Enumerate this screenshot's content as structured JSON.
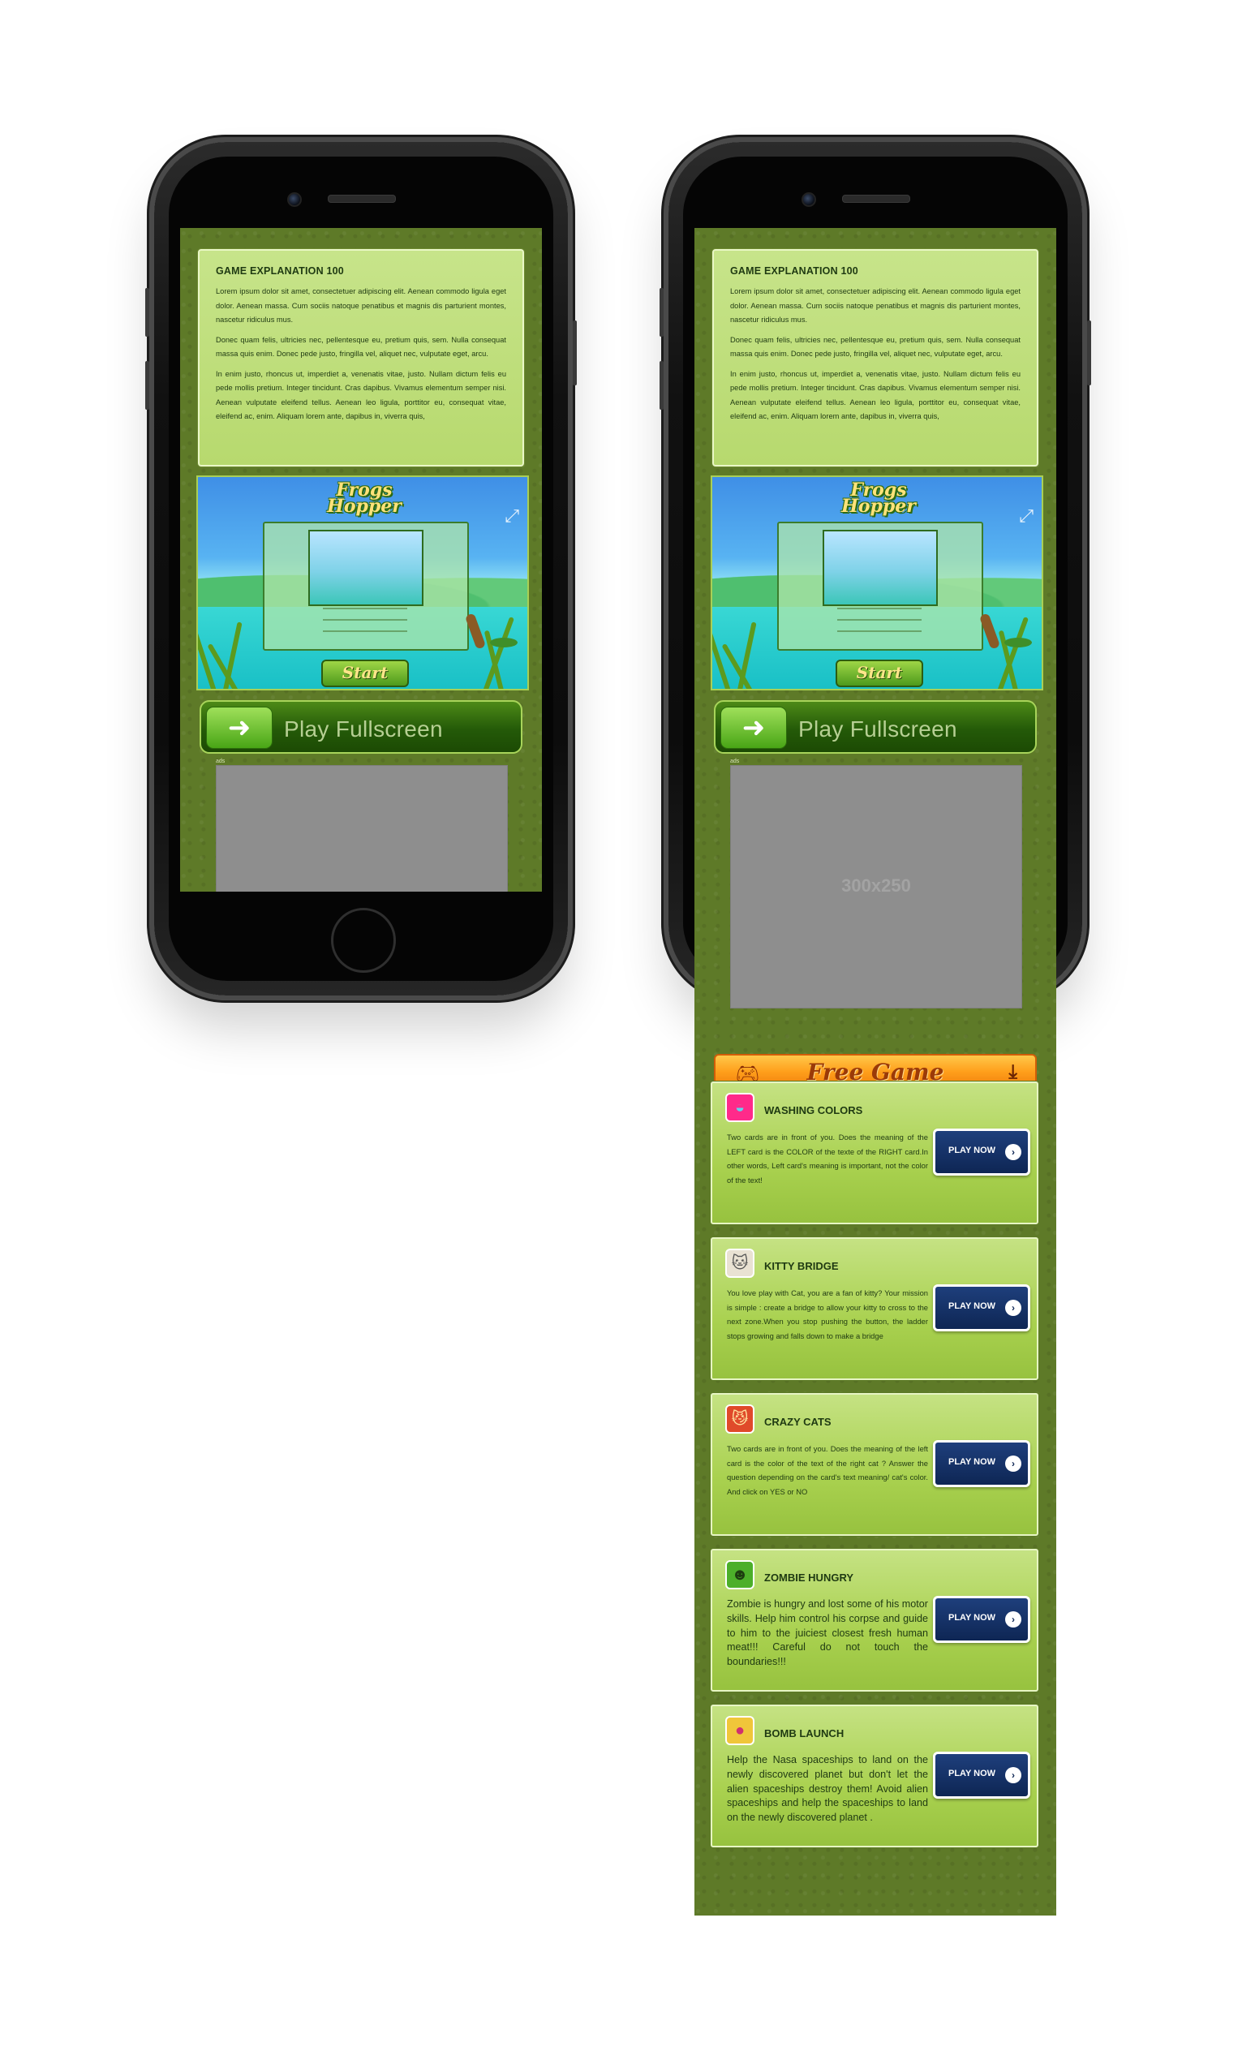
{
  "explanation": {
    "title": "GAME EXPLANATION 100",
    "p1": "Lorem ipsum dolor sit amet, consectetuer adipiscing elit. Aenean commodo ligula eget dolor. Aenean massa. Cum sociis natoque penatibus et magnis dis parturient montes, nascetur ridiculus mus.",
    "p2": "Donec quam felis, ultricies nec, pellentesque eu, pretium quis, sem. Nulla consequat massa quis enim. Donec pede justo, fringilla vel, aliquet nec, vulputate eget, arcu.",
    "p3": "In enim justo, rhoncus ut, imperdiet a, venenatis vitae, justo. Nullam dictum felis eu pede mollis pretium. Integer tincidunt. Cras dapibus. Vivamus elementum semper nisi. Aenean vulputate eleifend tellus. Aenean leo ligula, porttitor eu, consequat vitae, eleifend ac, enim. Aliquam lorem ante, dapibus in, viverra quis,"
  },
  "game": {
    "title_line1": "Frogs",
    "title_line2": "Hopper",
    "start_label": "Start",
    "fullscreen_icon": "expand-icon"
  },
  "play_fullscreen": {
    "label": "Play Fullscreen",
    "icon": "arrow-right-icon"
  },
  "ads": {
    "label": "ads",
    "placeholder": "300x250"
  },
  "free_game": {
    "label": "Free Game",
    "left_icon": "gamepad-icon",
    "right_icon": "download-icon"
  },
  "games": [
    {
      "title": "WASHING COLORS",
      "desc": "Two cards are in front of you. Does the meaning of the LEFT card is the COLOR of the texte of the RIGHT card.In other words, Left card's meaning is important, not the color of the text!",
      "button": "PLAY NOW",
      "icon": "palette-icon",
      "icon_color": "#ff2a8a"
    },
    {
      "title": "KITTY BRIDGE",
      "desc": "You love play with Cat, you are a fan of kitty? Your mission is simple : create a bridge to allow your kitty to cross to the next zone.When you stop pushing the button, the ladder stops growing and falls down to make a bridge",
      "button": "PLAY NOW",
      "icon": "cat-icon",
      "icon_color": "#e9e2d3"
    },
    {
      "title": "CRAZY CATS",
      "desc": "Two cards are in front of you. Does the meaning of the left card is the color of the text of the right cat ? Answer the question depending on the card's text meaning/ cat's color. And click on YES or NO",
      "button": "PLAY NOW",
      "icon": "crazy-cat-icon",
      "icon_color": "#e04a2a"
    },
    {
      "title": "ZOMBIE HUNGRY",
      "desc": "Zombie is hungry and lost some of his motor skills. Help him control his corpse and guide to him to the juiciest closest fresh human meat!!! Careful do not touch the boundaries!!!",
      "button": "PLAY NOW",
      "icon": "zombie-icon",
      "icon_color": "#4caf2a"
    },
    {
      "title": "BOMB LAUNCH",
      "desc": "Help the Nasa spaceships to land on the newly discovered planet but don't let the alien spaceships destroy them! Avoid alien spaceships and help the spaceships to land on the newly discovered planet .",
      "button": "PLAY NOW",
      "icon": "bomb-icon",
      "icon_color": "#f0c63a"
    }
  ]
}
